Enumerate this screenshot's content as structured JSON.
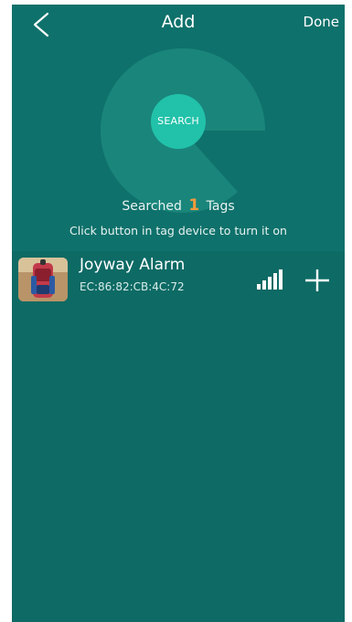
{
  "header": {
    "title": "Add",
    "done_label": "Done"
  },
  "scan": {
    "search_label": "SEARCH",
    "searched_prefix": "Searched",
    "searched_count": "1",
    "searched_suffix": "Tags",
    "hint": "Click button in tag device to turn it on"
  },
  "devices": [
    {
      "name": "Joyway Alarm",
      "mac": "EC:86:82:CB:4C:72",
      "icon": "backpack-thumbnail",
      "signal_icon": "signal-strength-icon"
    }
  ],
  "colors": {
    "background": "#0d6a64",
    "accent": "#21c2a9",
    "count": "#f39a3a"
  }
}
